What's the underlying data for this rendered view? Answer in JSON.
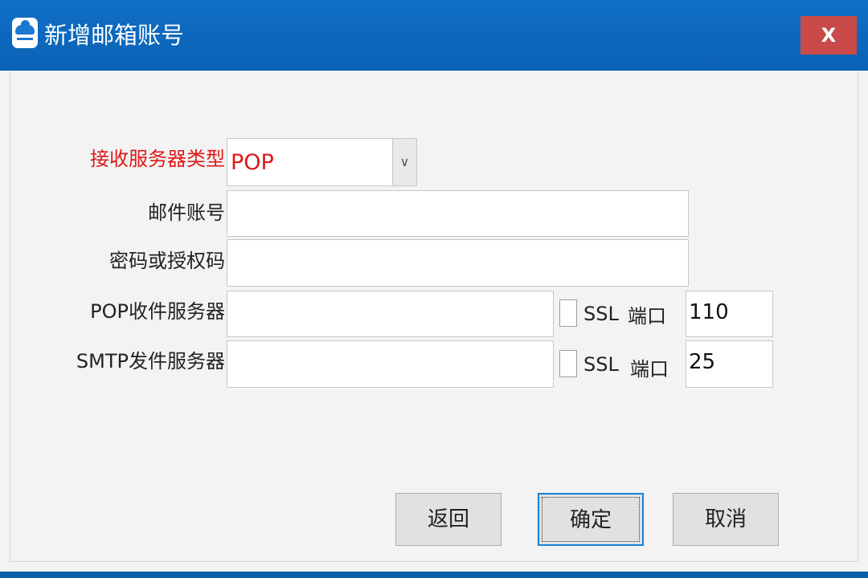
{
  "window": {
    "title": "新增邮箱账号",
    "close_label": "X"
  },
  "form": {
    "server_type": {
      "label": "接收服务器类型",
      "value": "POP",
      "arrow": "∨"
    },
    "account": {
      "label": "邮件账号",
      "value": ""
    },
    "password": {
      "label": "密码或授权码",
      "value": ""
    },
    "pop_server": {
      "label": "POP收件服务器",
      "value": "",
      "ssl_label": "SSL",
      "ssl_checked": false,
      "port_label": "端口",
      "port_value": "110"
    },
    "smtp_server": {
      "label": "SMTP发件服务器",
      "value": "",
      "ssl_label": "SSL",
      "ssl_checked": false,
      "port_label": "端口",
      "port_value": "25"
    }
  },
  "buttons": {
    "back": "返回",
    "confirm": "确定",
    "cancel": "取消"
  },
  "colors": {
    "titlebar": "#0a62b4",
    "close": "#c94a48",
    "required_label": "#e01818",
    "dialog_bg": "#f3f3f3"
  },
  "icons": {
    "app": "cloud-mail-icon",
    "close": "close-icon",
    "dropdown": "chevron-down-icon"
  }
}
